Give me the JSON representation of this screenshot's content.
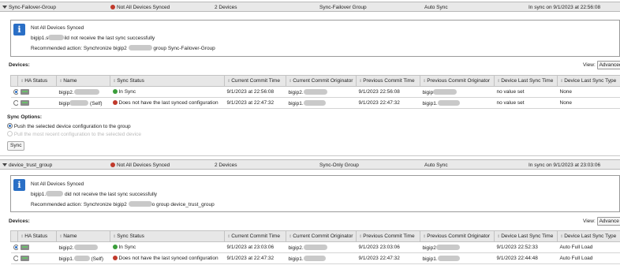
{
  "groups": [
    {
      "name": "Sync-Failover-Group",
      "status": "Not All Devices Synced",
      "device_count": "2 Devices",
      "group_type": "Sync-Failover Group",
      "sync_mode": "Auto Sync",
      "sync_time": "In sync on 9/1/2023 at 22:56:08",
      "info": {
        "title": "Not All Devices Synced",
        "line1_a": "bigip1.s",
        "line1_b": "ild not receive the last sync successfully",
        "line2_a": "Recommended action: Synchronize bigip2",
        "line2_b": "group Sync-Failover-Group"
      },
      "devices_label": "Devices:",
      "view_label": "View:",
      "view_value": "Advanced",
      "columns": [
        "HA Status",
        "Name",
        "Sync Status",
        "Current Commit Time",
        "Current Commit Originator",
        "Previous Commit Time",
        "Previous Commit Originator",
        "Device Last Sync Time",
        "Device Last Sync Type"
      ],
      "rows": [
        {
          "name": "bigip2.",
          "name_suffix": "",
          "sync_status": "In Sync",
          "status_color": "green",
          "cur_time": "9/1/2023 at 22:56:08",
          "cur_orig": "bigip2.",
          "prev_time": "9/1/2023 22:56:08",
          "prev_orig": "bigip",
          "last_sync_time": "no value set",
          "last_sync_type": "None"
        },
        {
          "name": "bigip",
          "name_suffix": "(Self)",
          "sync_status": "Does not have the last synced configuration",
          "status_color": "red",
          "cur_time": "9/1/2023 at 22:47:32",
          "cur_orig": "bigip1.",
          "prev_time": "9/1/2023 22:47:32",
          "prev_orig": "bigip1.",
          "last_sync_time": "no value set",
          "last_sync_type": "None"
        }
      ],
      "sync_options_label": "Sync Options:",
      "option1": "Push the selected device configuration to the group",
      "option2": "Pull the most recent configuration to the selected device",
      "sync_button": "Sync"
    },
    {
      "name": "device_trust_group",
      "status": "Not All Devices Synced",
      "device_count": "2 Devices",
      "group_type": "Sync-Only Group",
      "sync_mode": "Auto Sync",
      "sync_time": "In sync on 9/1/2023 at 23:03:06",
      "info": {
        "title": "Not All Devices Synced",
        "line1_a": "bigip1.",
        "line1_b": "did not receive the last sync successfully",
        "line2_a": "Recommended action: Synchronize bigip2",
        "line2_b": "o group device_trust_group"
      },
      "devices_label": "Devices:",
      "view_label": "View:",
      "view_value": "Advance",
      "columns": [
        "HA Status",
        "Name",
        "Sync Status",
        "Current Commit Time",
        "Current Commit Originator",
        "Previous Commit Time",
        "Previous Commit Originator",
        "Device Last Sync Time",
        "Device Last Sync Type"
      ],
      "rows": [
        {
          "name": "bigip2.",
          "name_suffix": "",
          "sync_status": "In Sync",
          "status_color": "green",
          "cur_time": "9/1/2023 at 23:03:06",
          "cur_orig": "bigip2.",
          "prev_time": "9/1/2023 23:03:06",
          "prev_orig": "bigip2",
          "last_sync_time": "9/1/2023 22:52:33",
          "last_sync_type": "Auto Full Load"
        },
        {
          "name": "bigip1.",
          "name_suffix": "(Self)",
          "sync_status": "Does not have the last synced configuration",
          "status_color": "red",
          "cur_time": "9/1/2023 at 22:47:32",
          "cur_orig": "bigip1.",
          "prev_time": "9/1/2023 22:47:32",
          "prev_orig": "bigip1.",
          "last_sync_time": "9/1/2023 22:44:48",
          "last_sync_type": "Auto Full Load"
        }
      ]
    }
  ]
}
